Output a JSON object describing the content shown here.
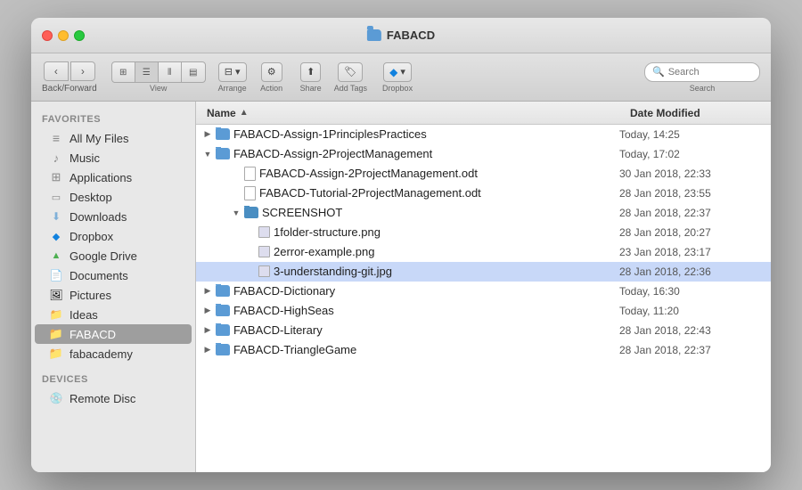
{
  "window": {
    "title": "FABACD"
  },
  "toolbar": {
    "back_label": "‹",
    "forward_label": "›",
    "nav_label": "Back/Forward",
    "view_label": "View",
    "arrange_label": "Arrange",
    "action_label": "Action",
    "share_label": "Share",
    "addtags_label": "Add Tags",
    "dropbox_label": "Dropbox",
    "search_label": "Search",
    "search_placeholder": "Search"
  },
  "sidebar": {
    "favorites_label": "Favorites",
    "devices_label": "Devices",
    "items": [
      {
        "id": "all-my-files",
        "label": "All My Files",
        "icon": "all-files"
      },
      {
        "id": "music",
        "label": "Music",
        "icon": "music"
      },
      {
        "id": "applications",
        "label": "Applications",
        "icon": "apps"
      },
      {
        "id": "desktop",
        "label": "Desktop",
        "icon": "desktop"
      },
      {
        "id": "downloads",
        "label": "Downloads",
        "icon": "downloads"
      },
      {
        "id": "dropbox",
        "label": "Dropbox",
        "icon": "dropbox"
      },
      {
        "id": "google-drive",
        "label": "Google Drive",
        "icon": "gdrive"
      },
      {
        "id": "documents",
        "label": "Documents",
        "icon": "documents"
      },
      {
        "id": "pictures",
        "label": "Pictures",
        "icon": "pictures"
      },
      {
        "id": "ideas",
        "label": "Ideas",
        "icon": "ideas"
      },
      {
        "id": "fabacd",
        "label": "FABACD",
        "icon": "fabacd",
        "active": true
      },
      {
        "id": "fabacademy",
        "label": "fabacademy",
        "icon": "fabacademy"
      }
    ],
    "devices": [
      {
        "id": "remote-disc",
        "label": "Remote Disc",
        "icon": "remoteDisc"
      }
    ]
  },
  "file_pane": {
    "col_name": "Name",
    "col_date": "Date Modified",
    "rows": [
      {
        "id": "r1",
        "indent": 1,
        "toggle": "closed",
        "type": "folder",
        "name": "FABACD-Assign-1PrinciplesPractices",
        "date": "Today, 14:25"
      },
      {
        "id": "r2",
        "indent": 1,
        "toggle": "open",
        "type": "folder",
        "name": "FABACD-Assign-2ProjectManagement",
        "date": "Today, 17:02"
      },
      {
        "id": "r3",
        "indent": 2,
        "toggle": null,
        "type": "doc",
        "name": "FABACD-Assign-2ProjectManagement.odt",
        "date": "30 Jan 2018, 22:33"
      },
      {
        "id": "r4",
        "indent": 2,
        "toggle": null,
        "type": "doc",
        "name": "FABACD-Tutorial-2ProjectManagement.odt",
        "date": "28 Jan 2018, 23:55"
      },
      {
        "id": "r5",
        "indent": 2,
        "toggle": "open",
        "type": "folder",
        "name": "SCREENSHOT",
        "date": "28 Jan 2018, 22:37"
      },
      {
        "id": "r6",
        "indent": 3,
        "toggle": null,
        "type": "img",
        "name": "1folder-structure.png",
        "date": "28 Jan 2018, 20:27"
      },
      {
        "id": "r7",
        "indent": 3,
        "toggle": null,
        "type": "img",
        "name": "2error-example.png",
        "date": "23 Jan 2018, 23:17"
      },
      {
        "id": "r8",
        "indent": 3,
        "toggle": null,
        "type": "img",
        "name": "3-understanding-git.jpg",
        "date": "28 Jan 2018, 22:36",
        "selected": true
      },
      {
        "id": "r9",
        "indent": 1,
        "toggle": "closed",
        "type": "folder",
        "name": "FABACD-Dictionary",
        "date": "Today, 16:30"
      },
      {
        "id": "r10",
        "indent": 1,
        "toggle": "closed",
        "type": "folder",
        "name": "FABACD-HighSeas",
        "date": "Today, 11:20"
      },
      {
        "id": "r11",
        "indent": 1,
        "toggle": "closed",
        "type": "folder",
        "name": "FABACD-Literary",
        "date": "28 Jan 2018, 22:43"
      },
      {
        "id": "r12",
        "indent": 1,
        "toggle": "closed",
        "type": "folder",
        "name": "FABACD-TriangleGame",
        "date": "28 Jan 2018, 22:37"
      }
    ]
  }
}
